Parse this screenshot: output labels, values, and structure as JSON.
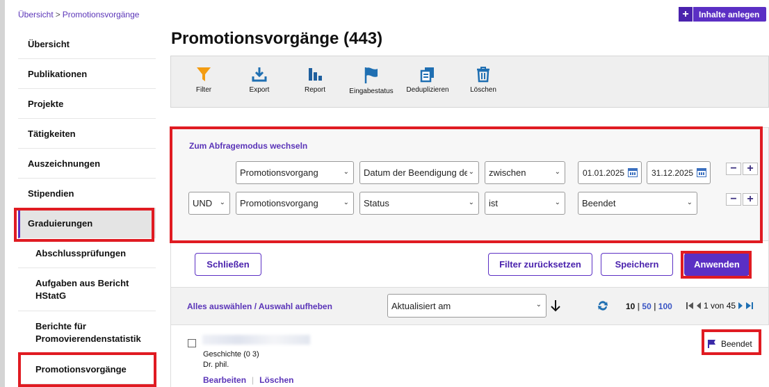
{
  "breadcrumb": {
    "root": "Übersicht",
    "separator": ">",
    "current": "Promotionsvorgänge"
  },
  "header_button": {
    "plus": "+",
    "label": "Inhalte anlegen"
  },
  "sidebar": {
    "items": [
      {
        "label": "Übersicht"
      },
      {
        "label": "Publikationen"
      },
      {
        "label": "Projekte"
      },
      {
        "label": "Tätigkeiten"
      },
      {
        "label": "Auszeichnungen"
      },
      {
        "label": "Stipendien"
      },
      {
        "label": "Graduierungen"
      },
      {
        "label": "Abschlussprüfungen"
      },
      {
        "label": "Aufgaben aus Bericht HStatG"
      },
      {
        "label": "Berichte für Promovierendenstatistik"
      },
      {
        "label": "Promotionsvorgänge"
      }
    ]
  },
  "page_title": "Promotionsvorgänge (443)",
  "toolbar": {
    "filter": "Filter",
    "export": "Export",
    "report": "Report",
    "eingabestatus": "Eingabestatus",
    "deduplizieren": "Deduplizieren",
    "loeschen": "Löschen"
  },
  "filter": {
    "query_mode_link": "Zum Abfragemodus wechseln",
    "row1": {
      "entity": "Promotionsvorgang",
      "field": "Datum der Beendigung des",
      "operator": "zwischen",
      "date_from": "01.01.2025",
      "date_to": "31.12.2025"
    },
    "row2": {
      "logic": "UND",
      "entity": "Promotionsvorgang",
      "field": "Status",
      "operator": "ist",
      "value": "Beendet"
    },
    "minus": "−",
    "plus": "+"
  },
  "actions": {
    "close": "Schließen",
    "reset": "Filter zurücksetzen",
    "save": "Speichern",
    "apply": "Anwenden"
  },
  "list": {
    "select_all": "Alles auswählen / Auswahl aufheben",
    "sort_by": "Aktualisiert am",
    "page_sizes": [
      "10",
      "50",
      "100"
    ],
    "page_info": "1 von 45"
  },
  "record": {
    "subject": "Geschichte (0  3)",
    "degree": "Dr. phil.",
    "edit": "Bearbeiten",
    "delete": "Löschen",
    "status": "Beendet"
  },
  "colors": {
    "accent": "#5b2fc4",
    "link": "#5a34b8",
    "highlight": "#e01b22",
    "filter_icon": "#f39c12",
    "icon_blue": "#1f6fb2"
  }
}
